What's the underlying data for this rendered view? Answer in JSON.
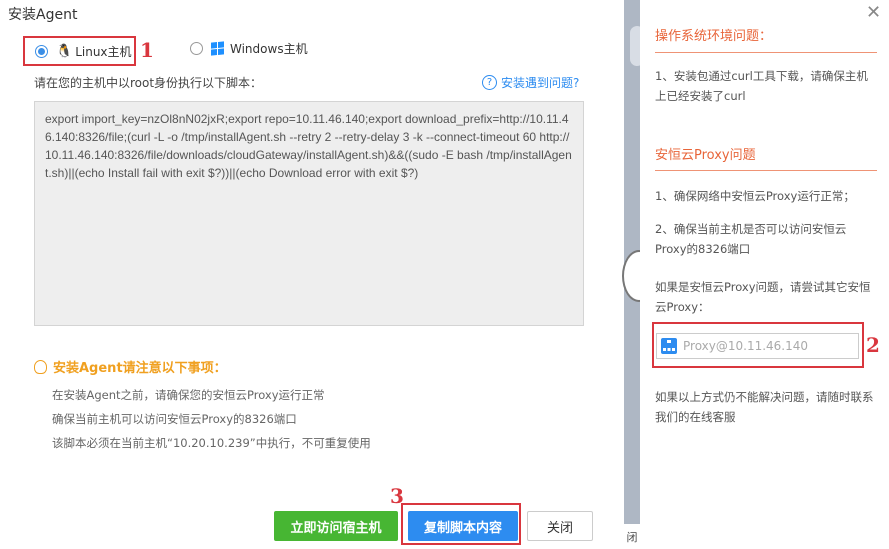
{
  "dialog": {
    "title": "安装Agent"
  },
  "os_options": [
    {
      "label": "Linux主机",
      "selected": true,
      "icon": "linux-penguin-icon"
    },
    {
      "label": "Windows主机",
      "selected": false,
      "icon": "windows-logo-icon"
    }
  ],
  "annotations": [
    "1",
    "2",
    "3"
  ],
  "instruction": "请在您的主机中以root身份执行以下脚本：",
  "help_link": "安装遇到问题?",
  "script": "export import_key=nzOl8nN02jxR;export repo=10.11.46.140;export download_prefix=http://10.11.46.140:8326/file;(curl -L -o /tmp/installAgent.sh --retry 2 --retry-delay 3 -k --connect-timeout 60 http://10.11.46.140:8326/file/downloads/cloudGateway/installAgent.sh)&&((sudo -E bash /tmp/installAgent.sh)||(echo Install fail with exit $?))||(echo Download error with exit $?)",
  "notice": {
    "title": "安装Agent请注意以下事项：",
    "items": [
      "在安装Agent之前，请确保您的安恒云Proxy运行正常",
      "确保当前主机可以访问安恒云Proxy的8326端口",
      "该脚本必须在当前主机“10.20.10.239”中执行，不可重复使用"
    ]
  },
  "buttons": {
    "visit_host": "立即访问宿主机",
    "copy_script": "复制脚本内容",
    "close": "关闭"
  },
  "side_strip_text": "闭",
  "help_panel": {
    "section1": {
      "title": "操作系统环境问题：",
      "text": "1、安装包通过curl工具下载，请确保主机上已经安装了curl"
    },
    "section2": {
      "title": "安恒云Proxy问题",
      "item1": "1、确保网络中安恒云Proxy运行正常；",
      "item2": "2、确保当前主机是否可以访问安恒云Proxy的8326端口",
      "hint": "如果是安恒云Proxy问题，请尝试其它安恒云Proxy：",
      "proxy_placeholder": "Proxy@10.11.46.140",
      "footer": "如果以上方式仍不能解决问题，请随时联系我们的在线客服"
    }
  },
  "colors": {
    "accent_red": "#d9363e",
    "primary_blue": "#2d8cf0",
    "green": "#47b633",
    "warning_orange": "#f0a020",
    "section_orange": "#e8653a"
  }
}
